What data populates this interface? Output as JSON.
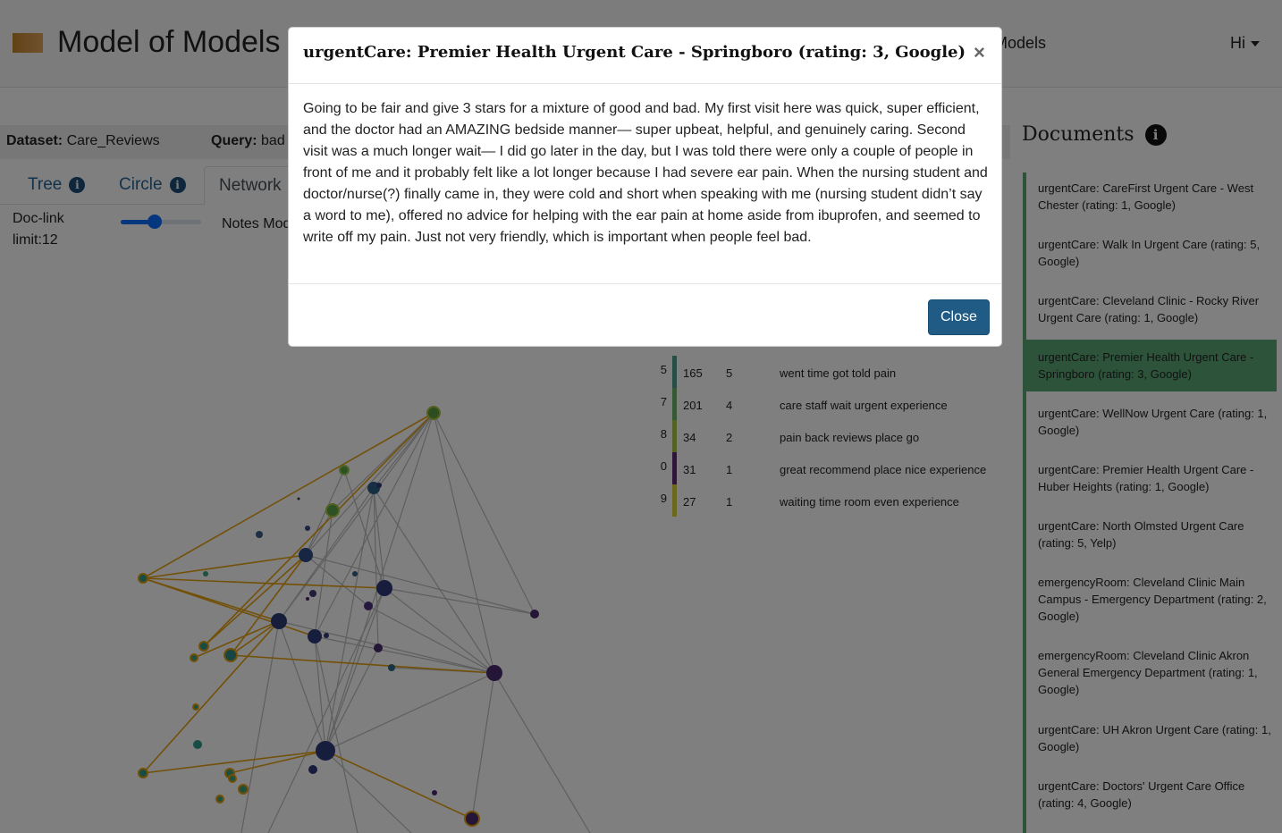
{
  "app": {
    "title": "Model of Models"
  },
  "nav": {
    "models": "Models",
    "user": "Hi"
  },
  "infobar": {
    "dataset_label": "Dataset:",
    "dataset_value": "Care_Reviews",
    "query_label": "Query:",
    "query_value": "bad"
  },
  "tabs": [
    {
      "label": "Tree"
    },
    {
      "label": "Circle"
    },
    {
      "label": "Network"
    }
  ],
  "controls": {
    "doclink_label": "Doc-link",
    "doclink_value": "limit:12",
    "notes_label": "Notes Mod"
  },
  "topics": [
    {
      "id": "5",
      "count": "165",
      "n": "5",
      "words": "went time got told pain",
      "color": "#4e9a8c"
    },
    {
      "id": "7",
      "count": "201",
      "n": "4",
      "words": "care staff wait urgent experience",
      "color": "#6cb06a"
    },
    {
      "id": "8",
      "count": "34",
      "n": "2",
      "words": "pain back reviews place go",
      "color": "#a5c74a"
    },
    {
      "id": "0",
      "count": "31",
      "n": "1",
      "words": "great recommend place nice experience",
      "color": "#5b2d6e"
    },
    {
      "id": "9",
      "count": "27",
      "n": "1",
      "words": "waiting time room even experience",
      "color": "#d8d23e"
    }
  ],
  "documents": {
    "heading": "Documents",
    "items": [
      {
        "text": "urgentCare: CareFirst Urgent Care - West Chester (rating: 1, Google)",
        "selected": false
      },
      {
        "text": "urgentCare: Walk In Urgent Care (rating: 5, Google)",
        "selected": false
      },
      {
        "text": "urgentCare: Cleveland Clinic - Rocky River Urgent Care (rating: 1, Google)",
        "selected": false
      },
      {
        "text": "urgentCare: Premier Health Urgent Care - Springboro (rating: 3, Google)",
        "selected": true
      },
      {
        "text": "urgentCare: WellNow Urgent Care (rating: 1, Google)",
        "selected": false
      },
      {
        "text": "urgentCare: Premier Health Urgent Care - Huber Heights (rating: 1, Google)",
        "selected": false
      },
      {
        "text": "urgentCare: North Olmsted Urgent Care (rating: 5, Yelp)",
        "selected": false
      },
      {
        "text": "emergencyRoom: Cleveland Clinic Main Campus - Emergency Department (rating: 2, Google)",
        "selected": false
      },
      {
        "text": "emergencyRoom: Cleveland Clinic Akron General Emergency Department (rating: 1, Google)",
        "selected": false
      },
      {
        "text": "urgentCare: UH Akron Urgent Care (rating: 1, Google)",
        "selected": false
      },
      {
        "text": "urgentCare: Doctors' Urgent Care Office (rating: 4, Google)",
        "selected": false
      }
    ]
  },
  "modal": {
    "title": "urgentCare: Premier Health Urgent Care - Springboro (rating: 3, Google)",
    "close_symbol": "×",
    "body": "Going to be fair and give 3 stars for a mixture of good and bad. My first visit here was quick, super efficient, and the doctor had an AMAZING bedside manner— super upbeat, helpful, and genuinely caring. Second visit was a much longer wait— I did go later in the day, but I was told there were only a couple of people in front of me and it probably felt like a lot longer because I had severe ear pain. When the nursing student and doctor/nurse(?) finally came in, they were cold and short when speaking with me (nursing student didn’t say a word to me), offered no advice for helping with the ear pain at home aside from ibuprofen, and seemed to write off my pain. Just not very friendly, which is important when people feel bad.",
    "close_button": "Close"
  },
  "colors": {
    "accent": "#1f5b84",
    "selected": "#5aa877",
    "highlight_edge": "#e6a00f"
  }
}
